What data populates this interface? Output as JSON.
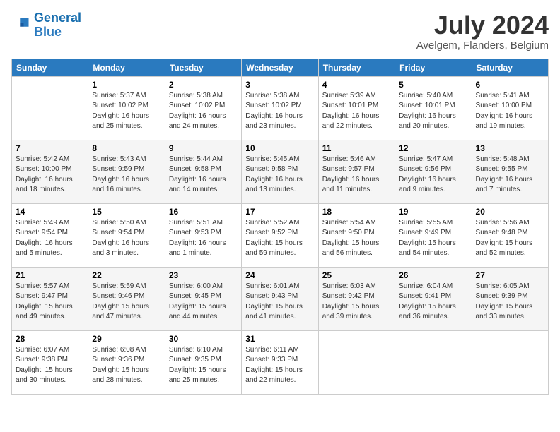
{
  "header": {
    "logo_line1": "General",
    "logo_line2": "Blue",
    "month": "July 2024",
    "location": "Avelgem, Flanders, Belgium"
  },
  "weekdays": [
    "Sunday",
    "Monday",
    "Tuesday",
    "Wednesday",
    "Thursday",
    "Friday",
    "Saturday"
  ],
  "weeks": [
    [
      {
        "num": "",
        "detail": ""
      },
      {
        "num": "1",
        "detail": "Sunrise: 5:37 AM\nSunset: 10:02 PM\nDaylight: 16 hours\nand 25 minutes."
      },
      {
        "num": "2",
        "detail": "Sunrise: 5:38 AM\nSunset: 10:02 PM\nDaylight: 16 hours\nand 24 minutes."
      },
      {
        "num": "3",
        "detail": "Sunrise: 5:38 AM\nSunset: 10:02 PM\nDaylight: 16 hours\nand 23 minutes."
      },
      {
        "num": "4",
        "detail": "Sunrise: 5:39 AM\nSunset: 10:01 PM\nDaylight: 16 hours\nand 22 minutes."
      },
      {
        "num": "5",
        "detail": "Sunrise: 5:40 AM\nSunset: 10:01 PM\nDaylight: 16 hours\nand 20 minutes."
      },
      {
        "num": "6",
        "detail": "Sunrise: 5:41 AM\nSunset: 10:00 PM\nDaylight: 16 hours\nand 19 minutes."
      }
    ],
    [
      {
        "num": "7",
        "detail": "Sunrise: 5:42 AM\nSunset: 10:00 PM\nDaylight: 16 hours\nand 18 minutes."
      },
      {
        "num": "8",
        "detail": "Sunrise: 5:43 AM\nSunset: 9:59 PM\nDaylight: 16 hours\nand 16 minutes."
      },
      {
        "num": "9",
        "detail": "Sunrise: 5:44 AM\nSunset: 9:58 PM\nDaylight: 16 hours\nand 14 minutes."
      },
      {
        "num": "10",
        "detail": "Sunrise: 5:45 AM\nSunset: 9:58 PM\nDaylight: 16 hours\nand 13 minutes."
      },
      {
        "num": "11",
        "detail": "Sunrise: 5:46 AM\nSunset: 9:57 PM\nDaylight: 16 hours\nand 11 minutes."
      },
      {
        "num": "12",
        "detail": "Sunrise: 5:47 AM\nSunset: 9:56 PM\nDaylight: 16 hours\nand 9 minutes."
      },
      {
        "num": "13",
        "detail": "Sunrise: 5:48 AM\nSunset: 9:55 PM\nDaylight: 16 hours\nand 7 minutes."
      }
    ],
    [
      {
        "num": "14",
        "detail": "Sunrise: 5:49 AM\nSunset: 9:54 PM\nDaylight: 16 hours\nand 5 minutes."
      },
      {
        "num": "15",
        "detail": "Sunrise: 5:50 AM\nSunset: 9:54 PM\nDaylight: 16 hours\nand 3 minutes."
      },
      {
        "num": "16",
        "detail": "Sunrise: 5:51 AM\nSunset: 9:53 PM\nDaylight: 16 hours\nand 1 minute."
      },
      {
        "num": "17",
        "detail": "Sunrise: 5:52 AM\nSunset: 9:52 PM\nDaylight: 15 hours\nand 59 minutes."
      },
      {
        "num": "18",
        "detail": "Sunrise: 5:54 AM\nSunset: 9:50 PM\nDaylight: 15 hours\nand 56 minutes."
      },
      {
        "num": "19",
        "detail": "Sunrise: 5:55 AM\nSunset: 9:49 PM\nDaylight: 15 hours\nand 54 minutes."
      },
      {
        "num": "20",
        "detail": "Sunrise: 5:56 AM\nSunset: 9:48 PM\nDaylight: 15 hours\nand 52 minutes."
      }
    ],
    [
      {
        "num": "21",
        "detail": "Sunrise: 5:57 AM\nSunset: 9:47 PM\nDaylight: 15 hours\nand 49 minutes."
      },
      {
        "num": "22",
        "detail": "Sunrise: 5:59 AM\nSunset: 9:46 PM\nDaylight: 15 hours\nand 47 minutes."
      },
      {
        "num": "23",
        "detail": "Sunrise: 6:00 AM\nSunset: 9:45 PM\nDaylight: 15 hours\nand 44 minutes."
      },
      {
        "num": "24",
        "detail": "Sunrise: 6:01 AM\nSunset: 9:43 PM\nDaylight: 15 hours\nand 41 minutes."
      },
      {
        "num": "25",
        "detail": "Sunrise: 6:03 AM\nSunset: 9:42 PM\nDaylight: 15 hours\nand 39 minutes."
      },
      {
        "num": "26",
        "detail": "Sunrise: 6:04 AM\nSunset: 9:41 PM\nDaylight: 15 hours\nand 36 minutes."
      },
      {
        "num": "27",
        "detail": "Sunrise: 6:05 AM\nSunset: 9:39 PM\nDaylight: 15 hours\nand 33 minutes."
      }
    ],
    [
      {
        "num": "28",
        "detail": "Sunrise: 6:07 AM\nSunset: 9:38 PM\nDaylight: 15 hours\nand 30 minutes."
      },
      {
        "num": "29",
        "detail": "Sunrise: 6:08 AM\nSunset: 9:36 PM\nDaylight: 15 hours\nand 28 minutes."
      },
      {
        "num": "30",
        "detail": "Sunrise: 6:10 AM\nSunset: 9:35 PM\nDaylight: 15 hours\nand 25 minutes."
      },
      {
        "num": "31",
        "detail": "Sunrise: 6:11 AM\nSunset: 9:33 PM\nDaylight: 15 hours\nand 22 minutes."
      },
      {
        "num": "",
        "detail": ""
      },
      {
        "num": "",
        "detail": ""
      },
      {
        "num": "",
        "detail": ""
      }
    ]
  ]
}
